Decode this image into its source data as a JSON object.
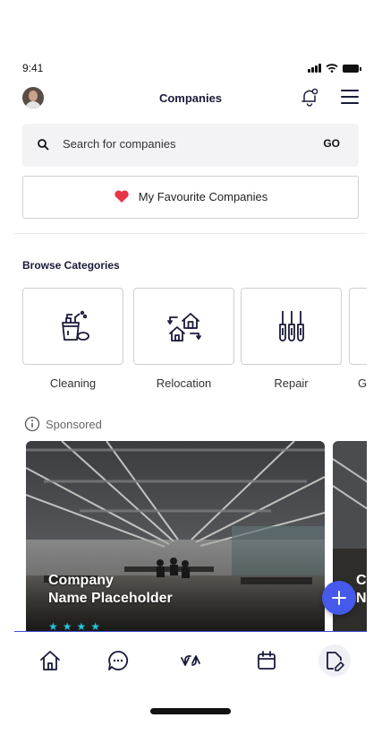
{
  "status": {
    "time": "9:41"
  },
  "header": {
    "title": "Companies",
    "avatar": "user-avatar",
    "notification_icon": "bell-icon",
    "menu_icon": "hamburger-menu-icon"
  },
  "search": {
    "placeholder": "Search for companies",
    "go_label": "GO",
    "icon": "search-icon"
  },
  "favourites": {
    "label": "My Favourite Companies",
    "icon": "heart-icon",
    "icon_color": "#e8354a"
  },
  "categories": {
    "title": "Browse Categories",
    "items": [
      {
        "label": "Cleaning",
        "icon": "cleaning-supplies-icon"
      },
      {
        "label": "Relocation",
        "icon": "moving-house-icon"
      },
      {
        "label": "Repair",
        "icon": "tools-icon"
      },
      {
        "label": "G",
        "icon": ""
      }
    ]
  },
  "sponsored": {
    "label": "Sponsored",
    "cards": [
      {
        "title_line1": "Company",
        "title_line2": "Name Placeholder",
        "stars": "★★★★"
      },
      {
        "title_line1": "C",
        "title_line2": "N"
      }
    ]
  },
  "fab": {
    "icon": "plus-icon",
    "color": "#4559ea"
  },
  "tabbar": {
    "items": [
      "home-icon",
      "chat-icon",
      "exchange-icon",
      "calendar-icon",
      "company-edit-icon"
    ],
    "active": "company-edit-icon",
    "accent": "#3e4ed6"
  }
}
